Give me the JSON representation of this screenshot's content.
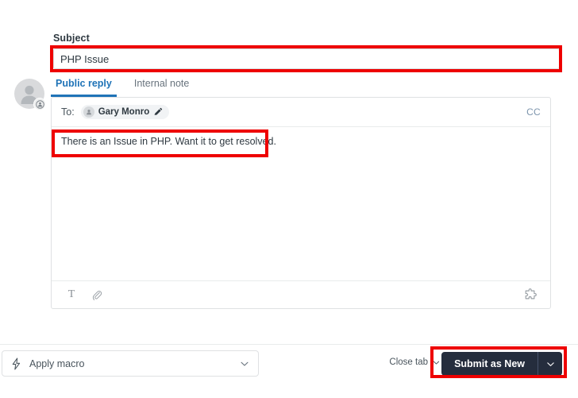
{
  "subject": {
    "label": "Subject",
    "value": "PHP Issue",
    "placeholder": "Subject"
  },
  "tabs": [
    {
      "label": "Public reply",
      "active": true
    },
    {
      "label": "Internal note",
      "active": false
    }
  ],
  "composer": {
    "to_label": "To:",
    "recipient": "Gary Monro",
    "cc_label": "CC",
    "body_text": "There is an Issue in PHP. Want it to get resolved.",
    "toolbar": {
      "text_format": "T",
      "attach": "attachment",
      "apps": "apps"
    }
  },
  "footer": {
    "macro_label": "Apply macro",
    "close_tab_label": "Close tab",
    "submit_label": "Submit as New"
  },
  "colors": {
    "accent_blue": "#1f73b7",
    "submit_dark": "#252d3d",
    "annotation_red": "#ee0000",
    "cc_blue": "#7d95ad"
  }
}
